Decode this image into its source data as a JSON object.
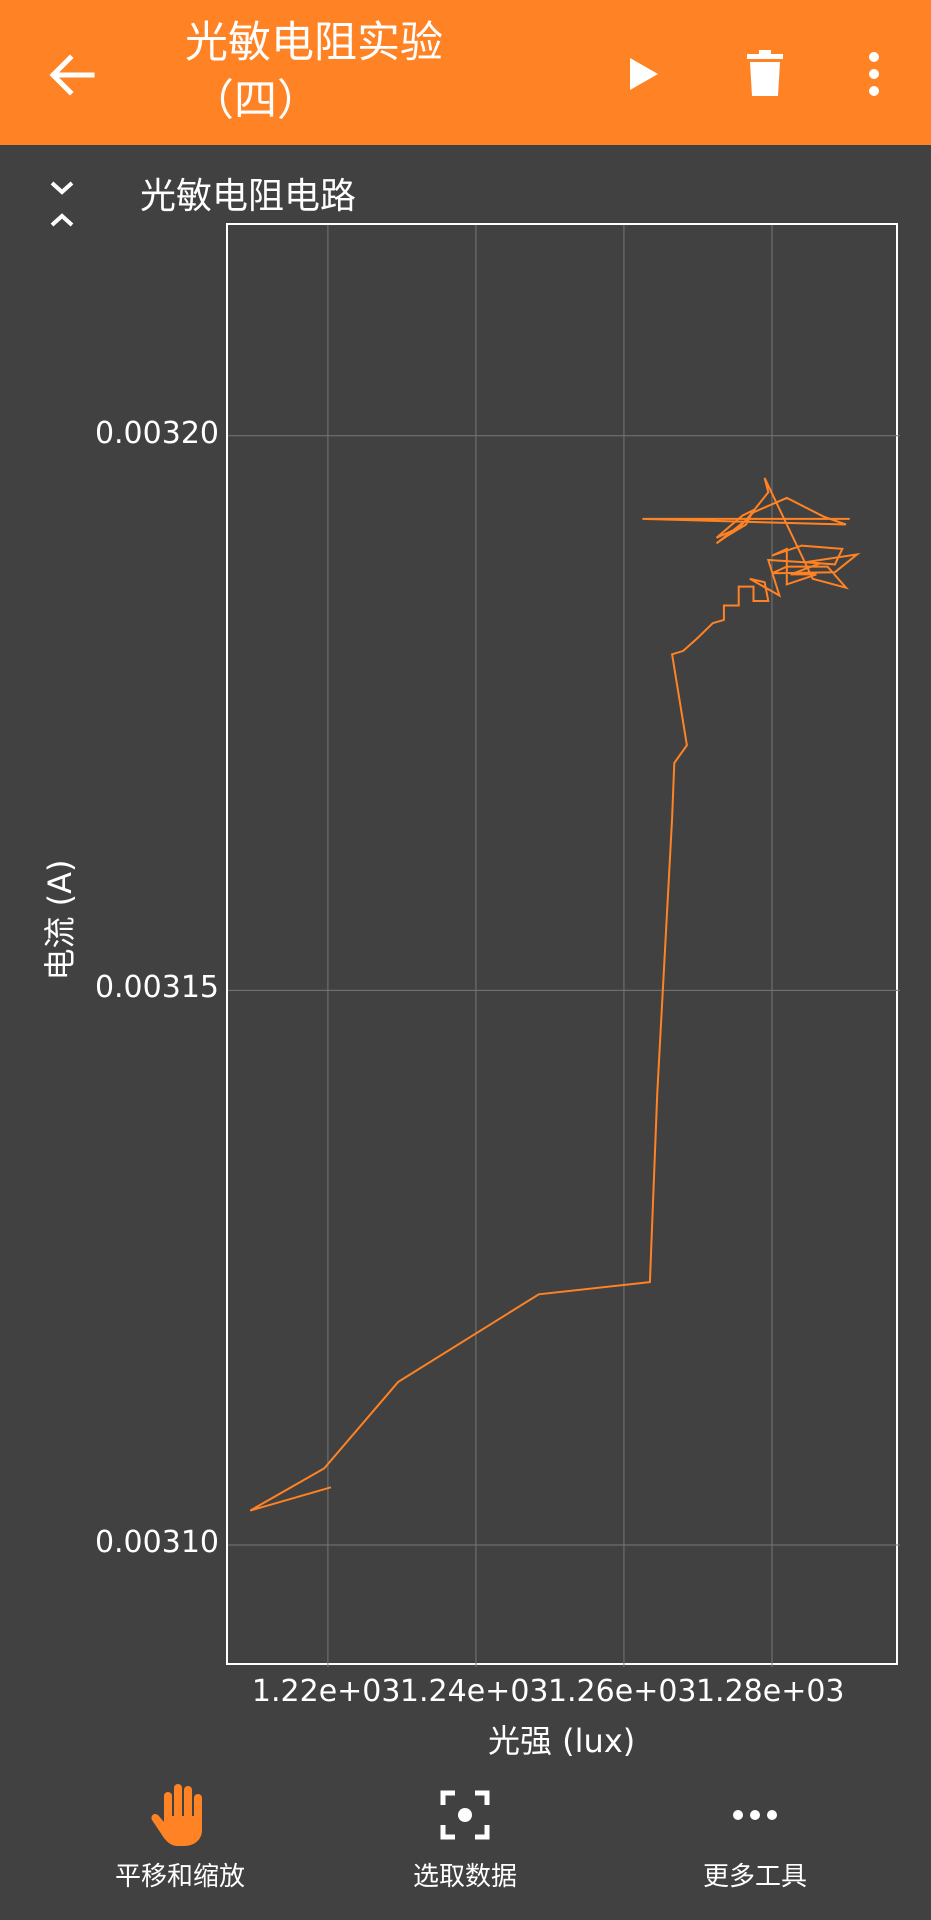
{
  "appbar": {
    "title_line1": "光敏电阻实验",
    "title_line2": "（四）",
    "back_icon": "arrow-left-icon",
    "play_icon": "play-icon",
    "delete_icon": "trash-icon",
    "more_icon": "more-vert-icon"
  },
  "section": {
    "title": "光敏电阻电路",
    "collapse_icon": "collapse-icon"
  },
  "colors": {
    "accent": "#ff8325",
    "background": "#414141",
    "line": "#ff8325",
    "grid": "#777777"
  },
  "chart_data": {
    "type": "line",
    "xlabel": "光强 (lux)",
    "ylabel": "电流 (A)",
    "xticks": [
      "1.22e+03",
      "1.24e+03",
      "1.26e+03",
      "1.28e+03"
    ],
    "xtick_values": [
      1220,
      1240,
      1260,
      1280
    ],
    "yticks": [
      "0.00310",
      "0.00315",
      "0.00320"
    ],
    "ytick_values": [
      0.0031,
      0.00315,
      0.0032
    ],
    "xlim": [
      1206.5,
      1297.3
    ],
    "ylim": [
      0.003089,
      0.003219
    ],
    "grid": true,
    "series": [
      {
        "color": "#ff8325",
        "x": [
          1220.4,
          1209.5,
          1219.5,
          1229.5,
          1248.5,
          1263.5,
          1264.5,
          1266.5,
          1266.8,
          1268.5,
          1266.5,
          1268.0,
          1270.0,
          1272.0,
          1273.5,
          1273.5,
          1275.5,
          1275.5,
          1277.5,
          1277.5,
          1279.5,
          1279.0,
          1277.0,
          1281.0,
          1279.5,
          1286.5,
          1282.5,
          1286.0,
          1282.0,
          1282.0,
          1280.0,
          1284.0,
          1289.5,
          1288.5,
          1284.5,
          1291.5,
          1288.5,
          1280.0,
          1282.0,
          1287.5,
          1290.0,
          1285.5,
          1279.0,
          1279.5,
          1276.5,
          1272.5,
          1274.0,
          1276.5,
          1277.5,
          1276.0,
          1272.5,
          1275.5,
          1277.5,
          1282.0,
          1287.0,
          1290.0,
          1262.5,
          1290.5
        ],
        "y": [
          0.0031052,
          0.0031031,
          0.0031069,
          0.0031147,
          0.0031226,
          0.0031237,
          0.0031408,
          0.0031655,
          0.0031705,
          0.0031721,
          0.0031803,
          0.0031806,
          0.0031818,
          0.0031831,
          0.0031834,
          0.0031847,
          0.0031847,
          0.0031864,
          0.0031864,
          0.0031851,
          0.0031851,
          0.0031868,
          0.0031871,
          0.0031856,
          0.0031888,
          0.0031885,
          0.0031875,
          0.0031875,
          0.0031866,
          0.0031898,
          0.0031892,
          0.0031901,
          0.0031898,
          0.0031884,
          0.0031886,
          0.0031893,
          0.0031877,
          0.0031876,
          0.0031882,
          0.0031882,
          0.0031863,
          0.0031871,
          0.0031962,
          0.0031949,
          0.0031924,
          0.0031903,
          0.003191,
          0.003192,
          0.0031933,
          0.0031928,
          0.0031908,
          0.0031917,
          0.0031931,
          0.0031944,
          0.0031927,
          0.003192,
          0.0031925,
          0.0031925
        ]
      }
    ]
  },
  "tools": [
    {
      "label": "平移和缩放",
      "icon": "hand-icon",
      "active": true
    },
    {
      "label": "选取数据",
      "icon": "select-data-icon",
      "active": false
    },
    {
      "label": "更多工具",
      "icon": "more-horiz-icon",
      "active": false
    }
  ]
}
